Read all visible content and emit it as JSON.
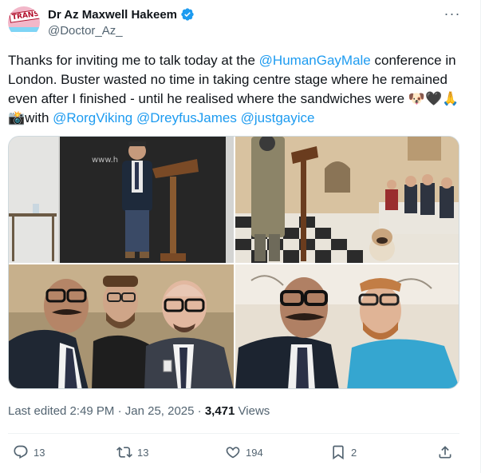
{
  "author": {
    "display_name": "Dr Az Maxwell Hakeem",
    "handle": "@Doctor_Az_",
    "avatar_text": "TRANS",
    "verified": true
  },
  "tweet": {
    "text_part1": "Thanks for inviting me to talk today at the ",
    "mention1": "@HumanGayMale",
    "text_part2": " conference in London. Buster wasted no time in taking centre stage where he remained even after I finished - until he realised where the sandwiches were 🐶🖤🙏 📸with ",
    "mention2": "@RorgViking",
    "text_part3": " ",
    "mention3": "@DreyfusJames",
    "text_part4": " ",
    "mention4": "@justgayice",
    "photo1_sign": "www.h"
  },
  "meta": {
    "edited": "Last edited 2:49 PM · Jan 25, 2025 · ",
    "views_count": "3,471",
    "views_label": " Views"
  },
  "actions": {
    "replies": "13",
    "reposts": "13",
    "likes": "194",
    "bookmarks": "2"
  },
  "colors": {
    "accent": "#1d9bf0",
    "secondary_text": "#536471"
  }
}
